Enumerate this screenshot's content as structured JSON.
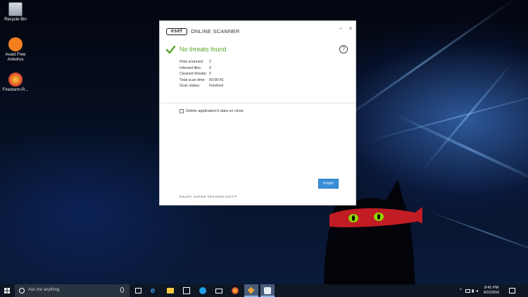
{
  "desktop": {
    "icons": [
      {
        "label": "Recycle Bin"
      },
      {
        "label": "Avast Free Antivirus"
      },
      {
        "label": "Firestorm-R..."
      }
    ]
  },
  "eset": {
    "logo_text": "eset",
    "product_name": "ONLINE SCANNER",
    "minimize_glyph": "–",
    "close_glyph": "×",
    "status": "No threats found",
    "help_glyph": "?",
    "stats": [
      {
        "label": "Files scanned:",
        "value": "2"
      },
      {
        "label": "Infected files:",
        "value": "0"
      },
      {
        "label": "Cleaned threats:",
        "value": "0"
      },
      {
        "label": "Total scan time:",
        "value": "00:00:42"
      },
      {
        "label": "Scan status:",
        "value": "Finished"
      }
    ],
    "delete_data_label": "Delete application's data on close",
    "delete_data_checked": false,
    "finish_label": "Finish",
    "slogan": "ENJOY SAFER TECHNOLOGY™"
  },
  "taskbar": {
    "search_placeholder": "Ask me anything",
    "clock_time": "9:41 PM",
    "clock_date": "9/22/2016"
  },
  "colors": {
    "status_green": "#5aa72c",
    "finish_blue": "#3a8fd9",
    "taskbar": "#0e1624"
  }
}
